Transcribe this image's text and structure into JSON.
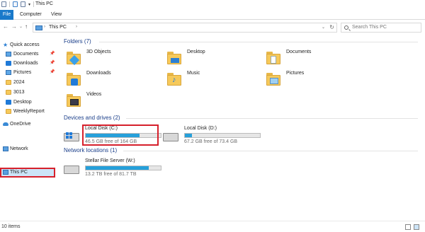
{
  "window": {
    "title": "This PC"
  },
  "ribbon": {
    "tabs": [
      "File",
      "Computer",
      "View"
    ]
  },
  "nav": {
    "address_location": "This PC",
    "search_placeholder": "Search This PC"
  },
  "sidebar": {
    "quick_access": "Quick access",
    "items": [
      {
        "label": "Documents",
        "icon": "documents-icon",
        "pinned": true
      },
      {
        "label": "Downloads",
        "icon": "downloads-icon",
        "pinned": true
      },
      {
        "label": "Pictures",
        "icon": "pictures-icon",
        "pinned": true
      },
      {
        "label": "2024",
        "icon": "folder-icon"
      },
      {
        "label": "3013",
        "icon": "folder-icon"
      },
      {
        "label": "Desktop",
        "icon": "desktop-icon"
      },
      {
        "label": "WeeklyReport",
        "icon": "folder-icon"
      }
    ],
    "onedrive": "OneDrive",
    "this_pc": "This PC",
    "network": "Network"
  },
  "folders": {
    "header": "Folders (7)",
    "items": [
      {
        "label": "3D Objects",
        "icon": "3d-objects-icon"
      },
      {
        "label": "Desktop",
        "icon": "desktop-folder-icon"
      },
      {
        "label": "Documents",
        "icon": "documents-folder-icon"
      },
      {
        "label": "Downloads",
        "icon": "downloads-folder-icon"
      },
      {
        "label": "Music",
        "icon": "music-folder-icon"
      },
      {
        "label": "Pictures",
        "icon": "pictures-folder-icon"
      },
      {
        "label": "Videos",
        "icon": "videos-folder-icon"
      }
    ]
  },
  "devices": {
    "header": "Devices and drives (2)",
    "drives": [
      {
        "name": "Local Disk (C:)",
        "free_text": "46.5 GB free of 164 GB",
        "used_fraction": 0.72
      },
      {
        "name": "Local Disk (D:)",
        "free_text": "67.2 GB free of 73.4 GB",
        "used_fraction": 0.09
      }
    ]
  },
  "network_locations": {
    "header": "Network locations (1)",
    "items": [
      {
        "name": "Stellar File Server (W:)",
        "free_text": "13.2 TB free of 81.7 TB",
        "used_fraction": 0.84
      }
    ]
  },
  "status": {
    "items_text": "10 items"
  },
  "colors": {
    "accent": "#1979ca",
    "drive_bar": "#26a0da",
    "highlight_red": "#d6202b",
    "group_header": "#1b3f8a"
  }
}
